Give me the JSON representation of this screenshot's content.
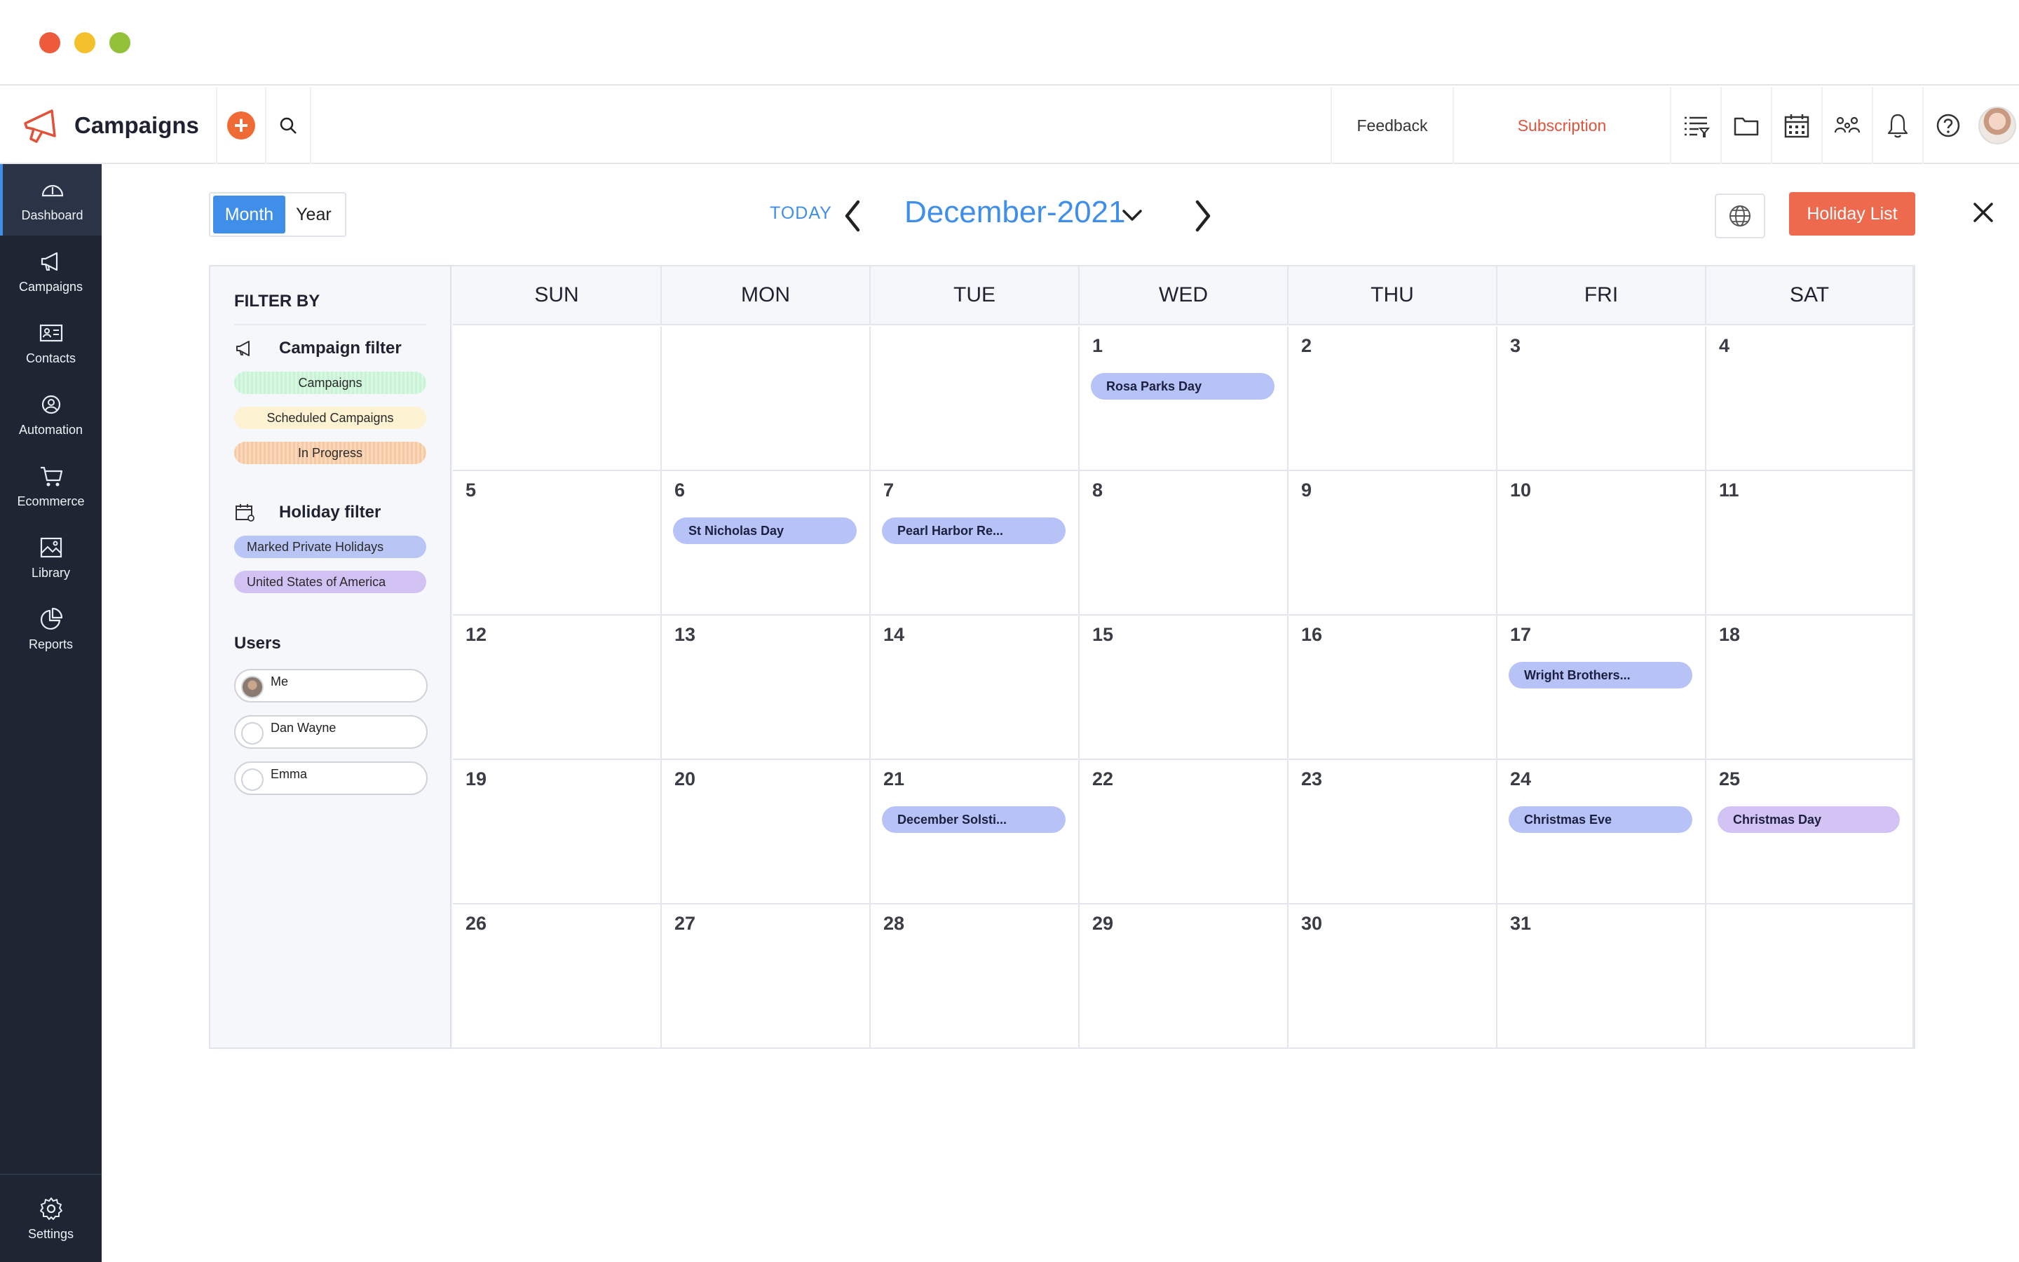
{
  "app": {
    "name": "Campaigns"
  },
  "header": {
    "feedback": "Feedback",
    "subscription": "Subscription",
    "icons": [
      "list-filter-icon",
      "folder-icon",
      "calendar-icon",
      "users-icon",
      "bell-icon",
      "help-icon",
      "avatar"
    ]
  },
  "sidebar": {
    "items": [
      {
        "label": "Dashboard",
        "icon": "dashboard-icon",
        "active": true
      },
      {
        "label": "Campaigns",
        "icon": "megaphone-icon",
        "active": false
      },
      {
        "label": "Contacts",
        "icon": "contact-card-icon",
        "active": false
      },
      {
        "label": "Automation",
        "icon": "automation-icon",
        "active": false
      },
      {
        "label": "Ecommerce",
        "icon": "cart-icon",
        "active": false
      },
      {
        "label": "Library",
        "icon": "image-library-icon",
        "active": false
      },
      {
        "label": "Reports",
        "icon": "pie-chart-icon",
        "active": false
      }
    ],
    "settings": "Settings"
  },
  "toolbar": {
    "view_month": "Month",
    "view_year": "Year",
    "active_view": "Month",
    "today": "TODAY",
    "month_title": "December-2021",
    "holiday_list": "Holiday List"
  },
  "filters": {
    "title": "FILTER BY",
    "campaign_filter": {
      "label": "Campaign filter",
      "chips": [
        "Campaigns",
        "Scheduled Campaigns",
        "In Progress"
      ]
    },
    "holiday_filter": {
      "label": "Holiday filter",
      "chips": [
        "Marked Private Holidays",
        "United States of America"
      ]
    },
    "users": {
      "label": "Users",
      "list": [
        "Me",
        "Dan Wayne",
        "Emma"
      ]
    }
  },
  "calendar": {
    "weekdays": [
      "SUN",
      "MON",
      "TUE",
      "WED",
      "THU",
      "FRI",
      "SAT"
    ],
    "weeks": [
      [
        "",
        "",
        "",
        "1",
        "2",
        "3",
        "4"
      ],
      [
        "5",
        "6",
        "7",
        "8",
        "9",
        "10",
        "11"
      ],
      [
        "12",
        "13",
        "14",
        "15",
        "16",
        "17",
        "18"
      ],
      [
        "19",
        "20",
        "21",
        "22",
        "23",
        "24",
        "25"
      ],
      [
        "26",
        "27",
        "28",
        "29",
        "30",
        "31",
        ""
      ]
    ],
    "events": [
      {
        "week": 0,
        "day": 3,
        "label": "Rosa Parks Day",
        "color": "#b7c3f6"
      },
      {
        "week": 1,
        "day": 1,
        "label": "St Nicholas Day",
        "color": "#b7c3f6"
      },
      {
        "week": 1,
        "day": 2,
        "label": "Pearl Harbor Re...",
        "color": "#b7c3f6"
      },
      {
        "week": 2,
        "day": 5,
        "label": "Wright Brothers...",
        "color": "#b7c3f6"
      },
      {
        "week": 3,
        "day": 2,
        "label": "December Solsti...",
        "color": "#b7c3f6"
      },
      {
        "week": 3,
        "day": 5,
        "label": "Christmas Eve",
        "color": "#b7c3f6"
      },
      {
        "week": 3,
        "day": 6,
        "label": "Christmas Day",
        "color": "#d3c3f4"
      }
    ]
  },
  "colors": {
    "accent": "#3f8ee8",
    "sidebar_bg": "#1e2533",
    "holiday_button": "#ee6a4e",
    "subscription_text": "#e0533a"
  }
}
